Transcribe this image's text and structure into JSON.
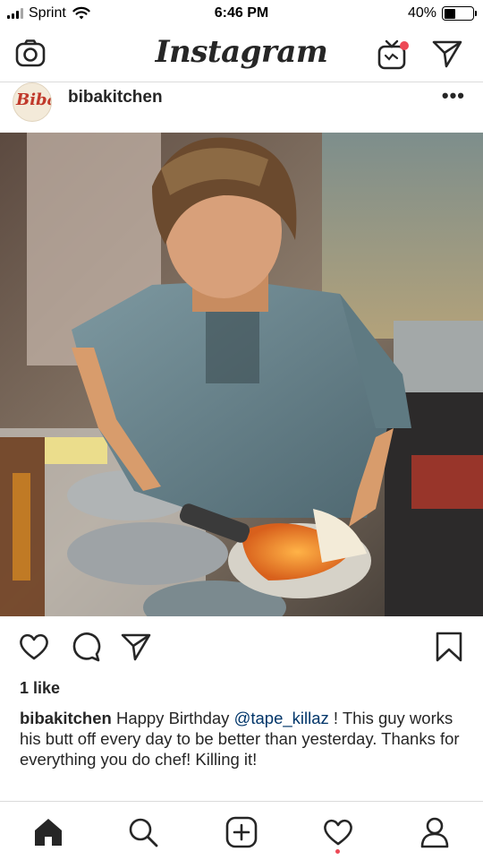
{
  "status_bar": {
    "carrier": "Sprint",
    "time": "6:46 PM",
    "battery_percent": "40%",
    "battery_level": 0.4
  },
  "header": {
    "title": "Instagram",
    "left_icon": "camera-icon",
    "right_icons": [
      "igtv-icon",
      "direct-message-icon"
    ]
  },
  "post": {
    "avatar_text": "Biba",
    "username": "bibakitchen",
    "more_label": "•••",
    "likes": "1 like",
    "caption": {
      "username": "bibakitchen",
      "text_before": "Happy Birthday ",
      "mention": "@tape_killaz",
      "text_after": " !  This guy works his butt off every day to be better than yesterday.  Thanks for everything you do chef!  Killing it!"
    },
    "action_icons": [
      "heart-icon",
      "comment-icon",
      "share-icon",
      "bookmark-icon"
    ]
  },
  "bottom_nav": {
    "items": [
      "home-icon",
      "search-icon",
      "new-post-icon",
      "activity-icon",
      "profile-icon"
    ]
  },
  "colors": {
    "text": "#262626",
    "divider": "#dbdbdb",
    "mention": "#003569",
    "notification": "#ed4956"
  }
}
